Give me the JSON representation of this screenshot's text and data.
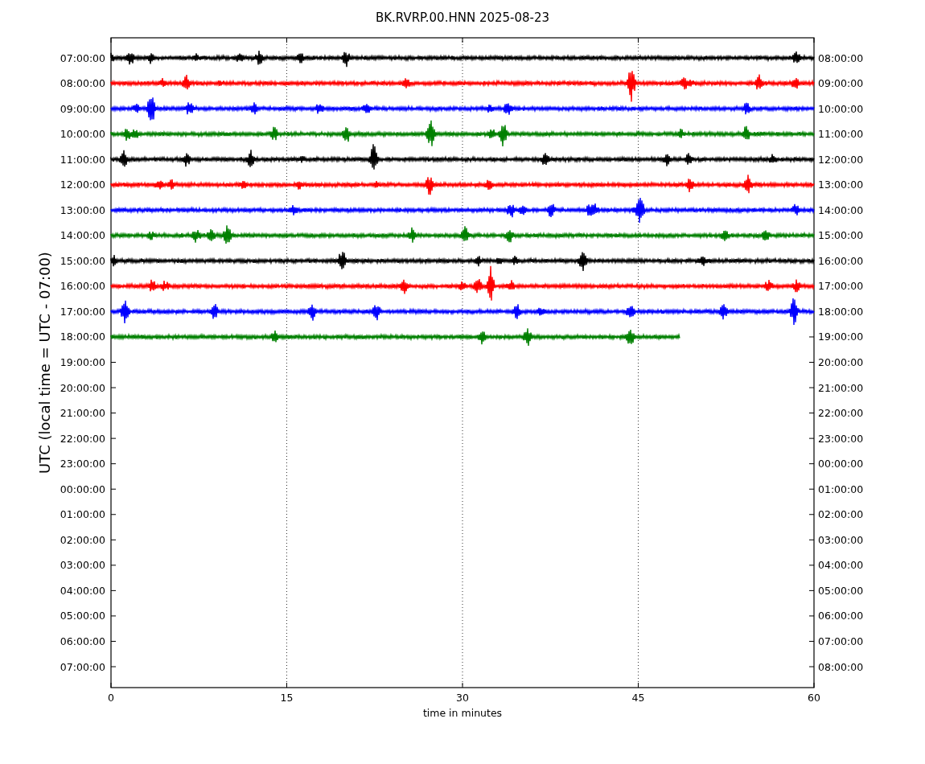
{
  "title": "BK.RVRP.00.HNN 2025-08-23",
  "ylabel": "UTC (local time = UTC - 07:00)",
  "xlabel": "time in minutes",
  "xticks": [
    "0",
    "15",
    "30",
    "45",
    "60"
  ],
  "left_labels": [
    "07:00:00",
    "08:00:00",
    "09:00:00",
    "10:00:00",
    "11:00:00",
    "12:00:00",
    "13:00:00",
    "14:00:00",
    "15:00:00",
    "16:00:00",
    "17:00:00",
    "18:00:00",
    "19:00:00",
    "20:00:00",
    "21:00:00",
    "22:00:00",
    "23:00:00",
    "00:00:00",
    "01:00:00",
    "02:00:00",
    "03:00:00",
    "04:00:00",
    "05:00:00",
    "06:00:00",
    "07:00:00"
  ],
  "right_labels": [
    "08:00:00",
    "09:00:00",
    "10:00:00",
    "11:00:00",
    "12:00:00",
    "13:00:00",
    "14:00:00",
    "15:00:00",
    "16:00:00",
    "17:00:00",
    "18:00:00",
    "19:00:00",
    "20:00:00",
    "21:00:00",
    "22:00:00",
    "23:00:00",
    "00:00:00",
    "01:00:00",
    "02:00:00",
    "03:00:00",
    "04:00:00",
    "05:00:00",
    "06:00:00",
    "07:00:00",
    "08:00:00"
  ],
  "traces": [
    {
      "color": "#000000",
      "level": 1
    },
    {
      "color": "#ff0000",
      "level": 1
    },
    {
      "color": "#0000ff",
      "level": 1
    },
    {
      "color": "#008000",
      "level": 1
    },
    {
      "color": "#000000",
      "level": 1
    },
    {
      "color": "#ff0000",
      "level": 1
    },
    {
      "color": "#0000ff",
      "level": 1
    },
    {
      "color": "#008000",
      "level": 1
    },
    {
      "color": "#000000",
      "level": 1
    },
    {
      "color": "#ff0000",
      "level": 1
    },
    {
      "color": "#0000ff",
      "level": 1
    },
    {
      "color": "#008000",
      "level": 0.81
    }
  ]
}
